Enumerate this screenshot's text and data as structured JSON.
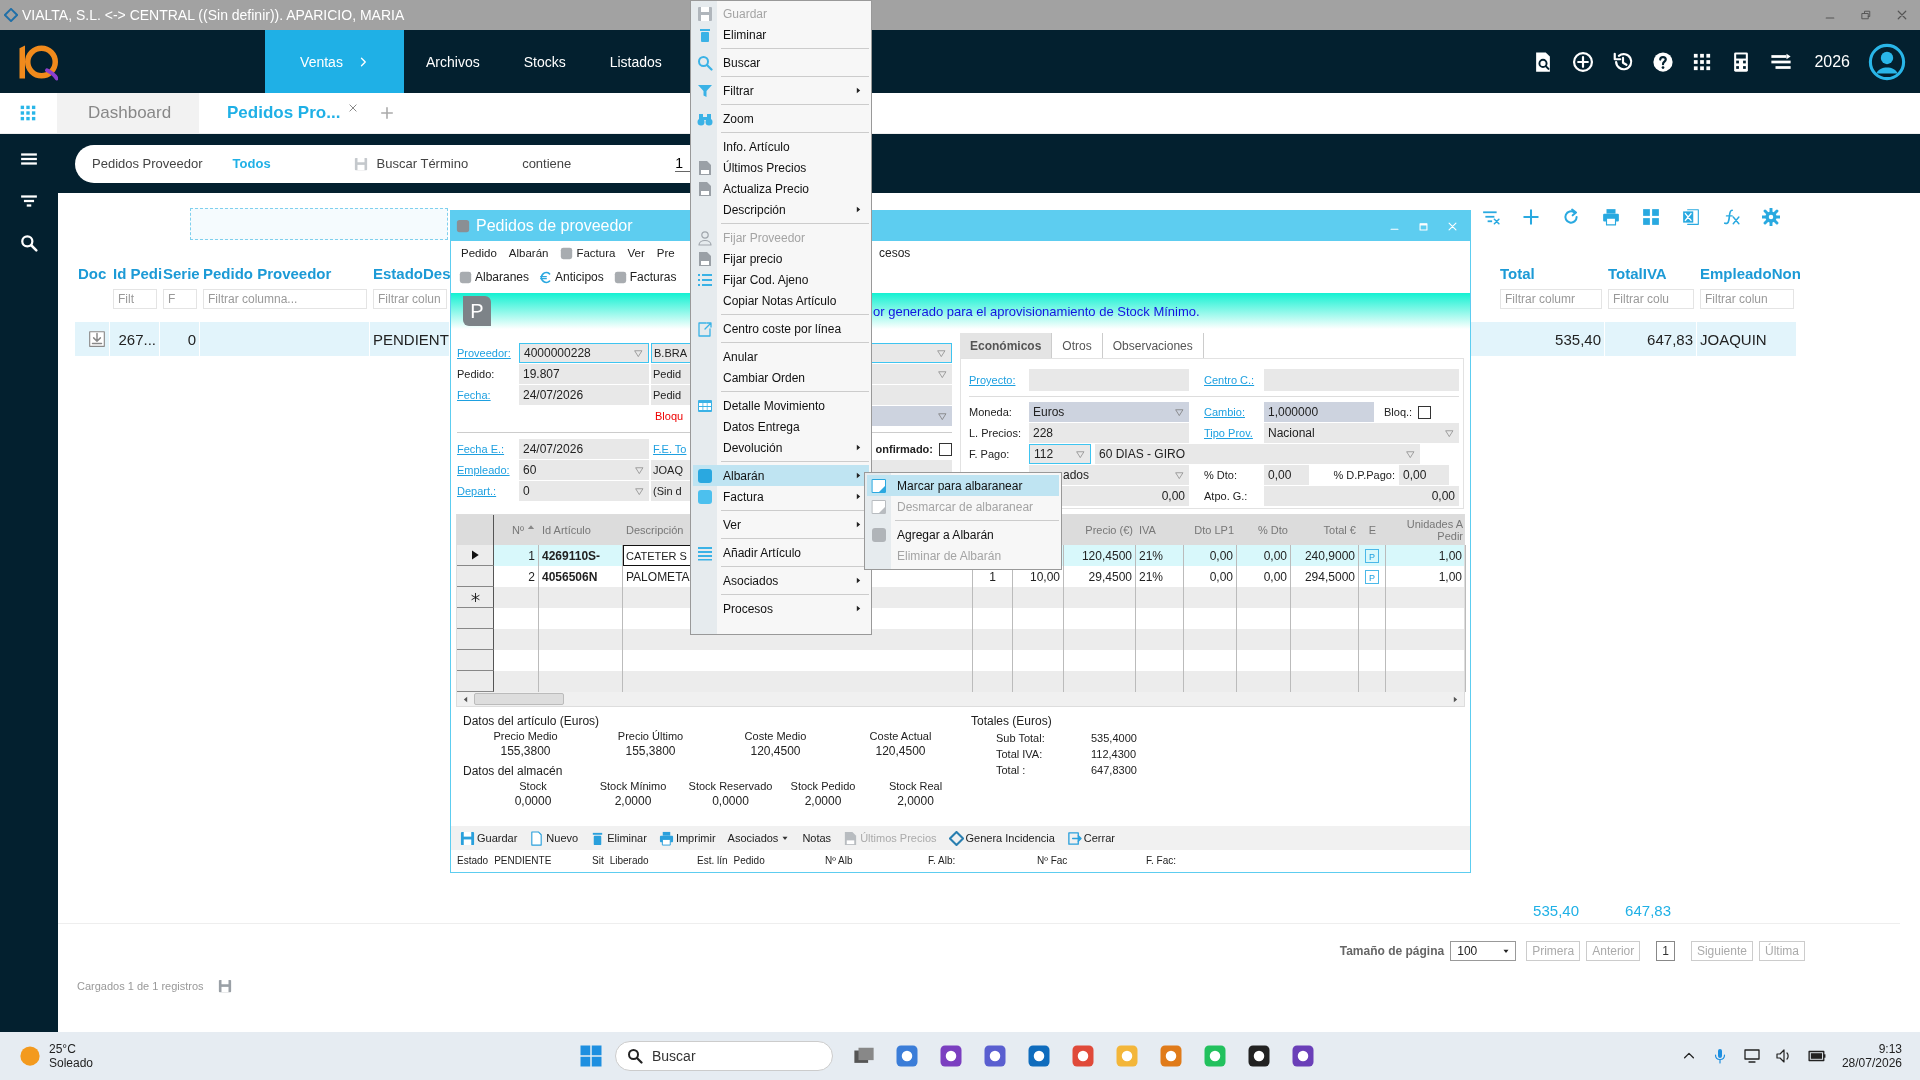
{
  "window_title": "VIALTA, S.L. <-> CENTRAL ((Sin definir)). APARICIO, MARIA",
  "nav": [
    {
      "label": "Ventas",
      "selected": true
    },
    {
      "label": "Archivos",
      "selected": false
    },
    {
      "label": "Stocks",
      "selected": false
    },
    {
      "label": "Listados",
      "selected": false
    }
  ],
  "year": "2026",
  "tabs": [
    {
      "label": "Dashboard",
      "selected": false
    },
    {
      "label": "Pedidos Pro...",
      "selected": true
    }
  ],
  "filter_bar": {
    "view": "Pedidos Proveedor",
    "scope": "Todos",
    "search_label": "Buscar Término",
    "operator": "contiene",
    "value": "1"
  },
  "grid": {
    "left_columns": [
      {
        "label": "Doc"
      },
      {
        "label": "Id Pedi",
        "placeholder": "Filt"
      },
      {
        "label": "Serie",
        "placeholder": "F"
      },
      {
        "label": "Pedido Proveedor",
        "placeholder": "Filtrar columna..."
      },
      {
        "label": "EstadoDes",
        "placeholder": "Filtrar colun"
      }
    ],
    "right_columns": [
      {
        "label": "Total",
        "placeholder": "Filtrar columr"
      },
      {
        "label": "TotalIVA",
        "placeholder": "Filtrar colu"
      },
      {
        "label": "EmpleadoNon",
        "placeholder": "Filtrar colun"
      }
    ],
    "rows": [
      {
        "selected": true,
        "left_cells": [
          null,
          "267...",
          "0",
          null,
          "PENDIENT"
        ],
        "right_cells": [
          "535,40",
          "647,83",
          "JOAQUIN"
        ]
      }
    ],
    "totals": [
      "535,40",
      "647,83"
    ]
  },
  "pagination": {
    "label": "Tamaño de página",
    "page_size": "100",
    "current_page": "1",
    "buttons": [
      {
        "label": "Primera",
        "disabled": true
      },
      {
        "label": "Anterior",
        "disabled": true
      },
      {
        "label": "Siguiente",
        "disabled": true
      },
      {
        "label": "Última",
        "disabled": true
      }
    ]
  },
  "status": "Cargados 1 de 1 registros",
  "dialog": {
    "title": "Pedidos de proveedor",
    "menu": [
      "Pedido",
      "Albarán",
      "Factura",
      "Ver",
      "Pre"
    ],
    "menu_tail": "cesos",
    "toolbar": [
      "Albaranes",
      "Anticipos",
      "Facturas"
    ],
    "banner_badge": "P",
    "banner": "or generado para el aprovisionamiento de Stock Mínimo.",
    "form": [
      {
        "kind": "field",
        "label": "Proveedor:",
        "link": true,
        "value": "4000000228",
        "dropdown": true,
        "focused": true,
        "extra": "B.BRA",
        "extra_dropdown": true
      },
      {
        "kind": "field",
        "label": "Pedido:",
        "link": false,
        "value": "19.807",
        "dropdown": false,
        "focused": false,
        "extra": "Pedid",
        "extra_dropdown": true
      },
      {
        "kind": "field",
        "label": "Fecha:",
        "link": true,
        "value": "24/07/2026",
        "dropdown": false,
        "focused": false,
        "extra": "Pedid",
        "extra_dropdown": false
      },
      {
        "kind": "warning",
        "text": "Bloqu"
      },
      {
        "kind": "field",
        "label": "Fecha E.:",
        "link": true,
        "value": "24/07/2026",
        "dropdown": false,
        "focused": false,
        "extra_link": "F.E. To",
        "check_label": "onfirmado:",
        "checked": false
      },
      {
        "kind": "field",
        "label": "Empleado:",
        "link": true,
        "value": "60",
        "dropdown": true,
        "focused": false,
        "extra": "JOAQ",
        "extra_dropdown": false
      },
      {
        "kind": "field",
        "label": "Depart.:",
        "link": true,
        "value": "0",
        "dropdown": true,
        "focused": false,
        "extra": "(Sin d",
        "extra_dropdown": false
      }
    ],
    "tabs": [
      {
        "label": "Económicos",
        "selected": true
      },
      {
        "label": "Otros",
        "selected": false
      },
      {
        "label": "Observaciones",
        "selected": false
      }
    ],
    "economics": {
      "proyecto": "Proyecto:",
      "centro": "Centro C.:",
      "moneda": {
        "label": "Moneda:",
        "value": "Euros"
      },
      "cambio": {
        "label": "Cambio:",
        "value": "1,000000"
      },
      "bloq": {
        "label": "Bloq.:",
        "checked": false
      },
      "l_precios": {
        "label": "L. Precios:",
        "value": "228"
      },
      "tipo_prov": {
        "label": "Tipo Prov.",
        "value": "Nacional"
      },
      "f_pago": {
        "label": "F. Pago:",
        "value": "112",
        "description": "60 DIAS - GIRO"
      },
      "field_4": "ados",
      "dto": {
        "label": "% Dto:",
        "value": "0,00"
      },
      "dpp": {
        "label": "% D.P.Pago:",
        "value": "0,00"
      },
      "field_5": "0,00",
      "atpo": {
        "label": "Atpo. G.:",
        "value": "0,00"
      }
    },
    "lines": {
      "columns": [
        "Nº",
        "Id Artículo",
        "Descripción",
        null,
        null,
        "Precio (€)",
        "IVA",
        "Dto LP1",
        "% Dto",
        "Total €",
        "E",
        "Unidades A Pedir"
      ],
      "rows": [
        {
          "selected": true,
          "cells": [
            "1",
            "4269110S-",
            "CATETER S",
            null,
            null,
            "120,4500",
            "21%",
            "0,00",
            "0,00",
            "240,9000",
            "P",
            "1,00"
          ]
        },
        {
          "selected": false,
          "cells": [
            "2",
            "4056506N",
            "PALOMETA",
            "1",
            "10,00",
            "29,4500",
            "21%",
            "0,00",
            "0,00",
            "294,5000",
            "P",
            "1,00"
          ]
        }
      ]
    },
    "article_title": "Datos del artículo (Euros)",
    "article": [
      {
        "label": "Precio Medio",
        "value": "155,3800"
      },
      {
        "label": "Precio Último",
        "value": "155,3800"
      },
      {
        "label": "Coste Medio",
        "value": "120,4500"
      },
      {
        "label": "Coste Actual",
        "value": "120,4500"
      }
    ],
    "warehouse_title": "Datos del almacén",
    "warehouse": [
      {
        "label": "Stock",
        "value": "0,0000"
      },
      {
        "label": "Stock Mínimo",
        "value": "2,0000"
      },
      {
        "label": "Stock Reservado",
        "value": "0,0000"
      },
      {
        "label": "Stock Pedido",
        "value": "2,0000"
      },
      {
        "label": "Stock Real",
        "value": "2,0000"
      }
    ],
    "totals_title": "Totales (Euros)",
    "totals": [
      {
        "label": "Sub Total:",
        "value": "535,4000"
      },
      {
        "label": "Total IVA:",
        "value": "112,4300"
      },
      {
        "label": "Total :",
        "value": "647,8300"
      }
    ],
    "actions": [
      {
        "label": "Guardar",
        "disabled": false
      },
      {
        "label": "Nuevo",
        "disabled": false
      },
      {
        "label": "Eliminar",
        "disabled": false
      },
      {
        "label": "Imprimir",
        "disabled": false
      },
      {
        "label": "Asociados",
        "disabled": false
      },
      {
        "label": "Notas",
        "disabled": false
      },
      {
        "label": "Últimos Precios",
        "disabled": true
      },
      {
        "label": "Genera Incidencia",
        "disabled": false
      },
      {
        "label": "Cerrar",
        "disabled": false
      }
    ],
    "status": [
      {
        "label": "Estado",
        "value": "PENDIENTE"
      },
      {
        "label": "Sit",
        "value": "Liberado"
      },
      {
        "label": "Est. lín",
        "value": "Pedido"
      },
      {
        "label": "Nº Alb"
      },
      {
        "label": "F. Alb:"
      },
      {
        "label": "Nº Fac"
      },
      {
        "label": "F. Fac:"
      }
    ]
  },
  "context_menu": [
    {
      "kind": "item",
      "label": "Guardar",
      "disabled": true,
      "submenu": false,
      "selected": false
    },
    {
      "kind": "item",
      "label": "Eliminar",
      "disabled": false,
      "submenu": false,
      "selected": false
    },
    {
      "kind": "separator"
    },
    {
      "kind": "item",
      "label": "Buscar",
      "disabled": false,
      "submenu": false,
      "selected": false
    },
    {
      "kind": "separator"
    },
    {
      "kind": "item",
      "label": "Filtrar",
      "disabled": false,
      "submenu": true,
      "selected": false
    },
    {
      "kind": "separator"
    },
    {
      "kind": "item",
      "label": "Zoom",
      "disabled": false,
      "submenu": false,
      "selected": false
    },
    {
      "kind": "separator"
    },
    {
      "kind": "item",
      "label": "Info. Artículo",
      "disabled": false,
      "submenu": false,
      "selected": false
    },
    {
      "kind": "item",
      "label": "Últimos Precios",
      "disabled": false,
      "submenu": false,
      "selected": false
    },
    {
      "kind": "item",
      "label": "Actualiza Precio",
      "disabled": false,
      "submenu": false,
      "selected": false
    },
    {
      "kind": "item",
      "label": "Descripción",
      "disabled": false,
      "submenu": true,
      "selected": false
    },
    {
      "kind": "separator"
    },
    {
      "kind": "item",
      "label": "Fijar Proveedor",
      "disabled": true,
      "submenu": false,
      "selected": false
    },
    {
      "kind": "item",
      "label": "Fijar precio",
      "disabled": false,
      "submenu": false,
      "selected": false
    },
    {
      "kind": "item",
      "label": "Fijar Cod. Ajeno",
      "disabled": false,
      "submenu": false,
      "selected": false
    },
    {
      "kind": "item",
      "label": "Copiar Notas Artículo",
      "disabled": false,
      "submenu": false,
      "selected": false
    },
    {
      "kind": "separator"
    },
    {
      "kind": "item",
      "label": "Centro coste por línea",
      "disabled": false,
      "submenu": false,
      "selected": false
    },
    {
      "kind": "separator"
    },
    {
      "kind": "item",
      "label": "Anular",
      "disabled": false,
      "submenu": false,
      "selected": false
    },
    {
      "kind": "item",
      "label": "Cambiar Orden",
      "disabled": false,
      "submenu": false,
      "selected": false
    },
    {
      "kind": "separator"
    },
    {
      "kind": "item",
      "label": "Detalle Movimiento",
      "disabled": false,
      "submenu": false,
      "selected": false
    },
    {
      "kind": "item",
      "label": "Datos Entrega",
      "disabled": false,
      "submenu": false,
      "selected": false
    },
    {
      "kind": "item",
      "label": "Devolución",
      "disabled": false,
      "submenu": true,
      "selected": false
    },
    {
      "kind": "separator"
    },
    {
      "kind": "item",
      "label": "Albarán",
      "disabled": false,
      "submenu": true,
      "selected": true
    },
    {
      "kind": "item",
      "label": "Factura",
      "disabled": false,
      "submenu": true,
      "selected": false
    },
    {
      "kind": "separator"
    },
    {
      "kind": "item",
      "label": "Ver",
      "disabled": false,
      "submenu": true,
      "selected": false
    },
    {
      "kind": "separator"
    },
    {
      "kind": "item",
      "label": "Añadir Artículo",
      "disabled": false,
      "submenu": false,
      "selected": false
    },
    {
      "kind": "separator"
    },
    {
      "kind": "item",
      "label": "Asociados",
      "disabled": false,
      "submenu": true,
      "selected": false
    },
    {
      "kind": "separator"
    },
    {
      "kind": "item",
      "label": "Procesos",
      "disabled": false,
      "submenu": true,
      "selected": false
    }
  ],
  "submenu": [
    {
      "kind": "item",
      "label": "Marcar para albaranear",
      "disabled": false,
      "selected": true
    },
    {
      "kind": "item",
      "label": "Desmarcar de albaranear",
      "disabled": true,
      "selected": false
    },
    {
      "kind": "separator"
    },
    {
      "kind": "item",
      "label": "Agregar a Albarán",
      "disabled": false,
      "selected": false
    },
    {
      "kind": "item",
      "label": "Eliminar de Albarán",
      "disabled": true,
      "selected": false
    }
  ],
  "taskbar": {
    "temperature": "25°C",
    "weather": "Soleado",
    "search": {
      "placeholder": "Buscar"
    },
    "time": "9:13",
    "date": "28/07/2026"
  }
}
